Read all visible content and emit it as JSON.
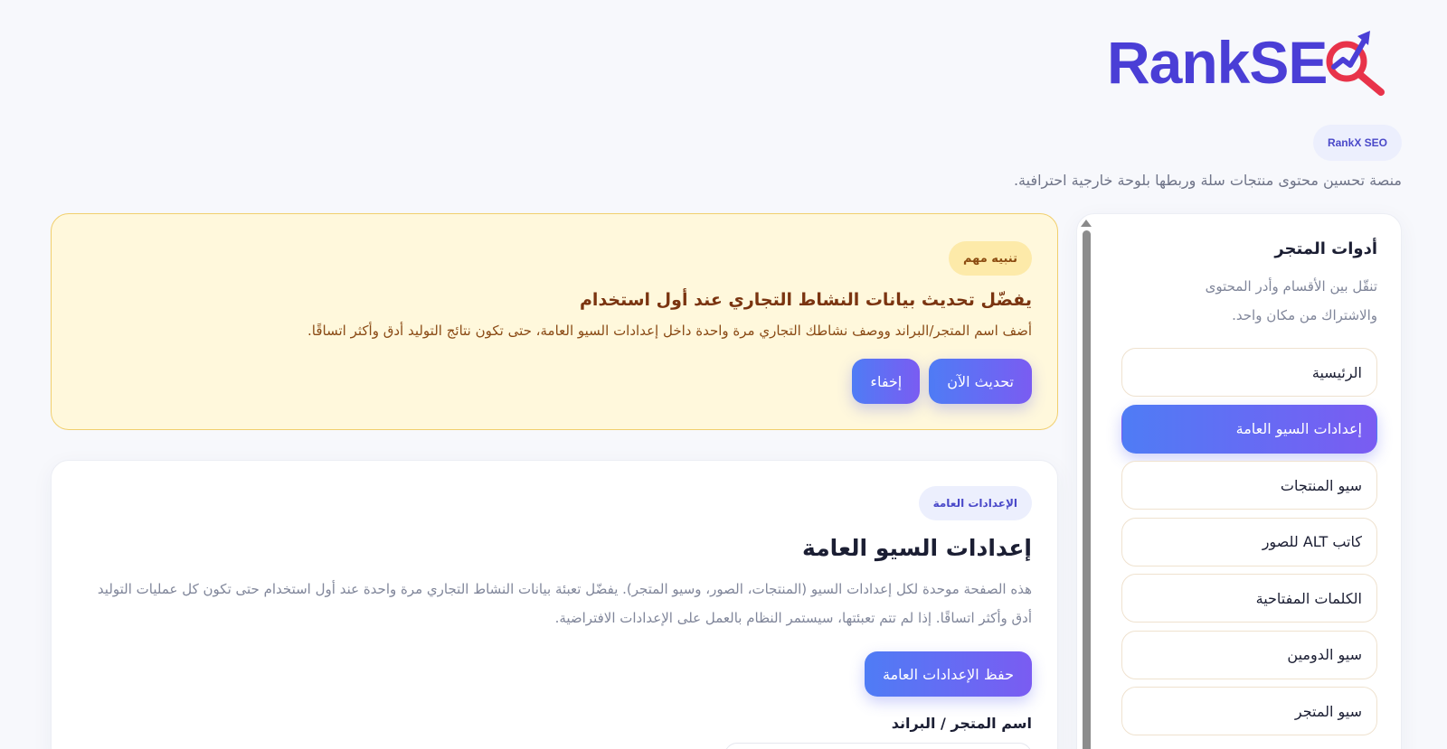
{
  "header": {
    "logo_rank": "Rank",
    "logo_seo_s": "SE",
    "brand_badge": "RankX SEO",
    "tagline": "منصة تحسين محتوى منتجات سلة وربطها بلوحة خارجية احترافية."
  },
  "sidebar": {
    "title": "أدوات المتجر",
    "description": "تنقّل بين الأقسام وأدر المحتوى والاشتراك من مكان واحد.",
    "items": [
      {
        "label": "الرئيسية",
        "active": false
      },
      {
        "label": "إعدادات السيو العامة",
        "active": true
      },
      {
        "label": "سيو المنتجات",
        "active": false
      },
      {
        "label": "كاتب ALT للصور",
        "active": false
      },
      {
        "label": "الكلمات المفتاحية",
        "active": false
      },
      {
        "label": "سيو الدومين",
        "active": false
      },
      {
        "label": "سيو المتجر",
        "active": false
      }
    ]
  },
  "alert": {
    "badge": "تنبيه مهم",
    "title": "يفضّل تحديث بيانات النشاط التجاري عند أول استخدام",
    "text": "أضف اسم المتجر/البراند ووصف نشاطك التجاري مرة واحدة داخل إعدادات السيو العامة، حتى تكون نتائج التوليد أدق وأكثر اتساقًا.",
    "update_button": "تحديث الآن",
    "hide_button": "إخفاء"
  },
  "main": {
    "badge": "الإعدادات العامة",
    "title": "إعدادات السيو العامة",
    "description": "هذه الصفحة موحدة لكل إعدادات السيو (المنتجات، الصور، وسيو المتجر). يفضّل تعبئة بيانات النشاط التجاري مرة واحدة عند أول استخدام حتى تكون كل عمليات التوليد أدق وأكثر اتساقًا. إذا لم تتم تعبئتها، سيستمر النظام بالعمل على الإعدادات الافتراضية.",
    "save_button": "حفظ الإعدادات العامة",
    "store_name_label": "اسم المتجر / البراند"
  },
  "colors": {
    "accent_start": "#4f7cf5",
    "accent_end": "#7a5cf2",
    "logo_blue": "#4a3ed6",
    "logo_red": "#e8334a",
    "alert_bg": "#fff8dc",
    "alert_border": "#f1cf6d"
  }
}
